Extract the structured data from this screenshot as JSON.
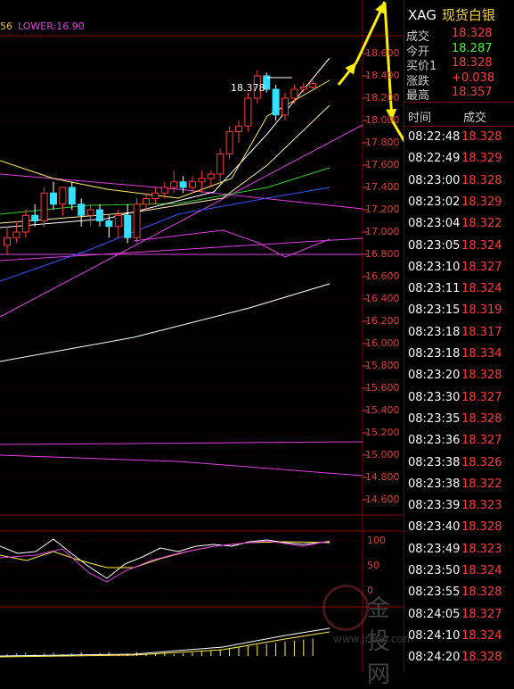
{
  "legend": {
    "partial": "56",
    "lower": "LOWER:16.90"
  },
  "high_marker": "18.378",
  "price_axis": [
    "18.600",
    "18.400",
    "18.200",
    "18.000",
    "17.800",
    "17.600",
    "17.400",
    "17.200",
    "17.000",
    "16.800",
    "16.600",
    "16.400",
    "16.200",
    "16.000",
    "15.800",
    "15.600",
    "15.400",
    "15.200",
    "15.000",
    "14.800",
    "14.600"
  ],
  "indicator_axis": [
    "100",
    "50",
    "0"
  ],
  "quote": {
    "symbol": "XAG",
    "name": "现货白银",
    "rows": [
      {
        "label": "成交",
        "value": "18.328",
        "color": "#ff3a3a"
      },
      {
        "label": "今开",
        "value": "18.287",
        "color": "#33ff33"
      },
      {
        "label": "买价1",
        "value": "18.328",
        "color": "#ff3a3a"
      },
      {
        "label": "涨跌",
        "value": "+0.038",
        "color": "#ff3a3a"
      },
      {
        "label": "最高",
        "value": "18.357",
        "color": "#ff3a3a"
      }
    ]
  },
  "ticks": {
    "header_time": "时间",
    "header_price": "成交",
    "rows": [
      {
        "time": "08:22:48",
        "price": "18.328"
      },
      {
        "time": "08:22:49",
        "price": "18.329"
      },
      {
        "time": "08:23:00",
        "price": "18.328"
      },
      {
        "time": "08:23:02",
        "price": "18.329"
      },
      {
        "time": "08:23:04",
        "price": "18.322"
      },
      {
        "time": "08:23:05",
        "price": "18.324"
      },
      {
        "time": "08:23:10",
        "price": "18.327"
      },
      {
        "time": "08:23:11",
        "price": "18.324"
      },
      {
        "time": "08:23:15",
        "price": "18.319"
      },
      {
        "time": "08:23:18",
        "price": "18.317"
      },
      {
        "time": "08:23:18",
        "price": "18.334"
      },
      {
        "time": "08:23:20",
        "price": "18.328"
      },
      {
        "time": "08:23:30",
        "price": "18.327"
      },
      {
        "time": "08:23:35",
        "price": "18.328"
      },
      {
        "time": "08:23:36",
        "price": "18.327"
      },
      {
        "time": "08:23:38",
        "price": "18.326"
      },
      {
        "time": "08:23:38",
        "price": "18.322"
      },
      {
        "time": "08:23:39",
        "price": "18.323"
      },
      {
        "time": "08:23:40",
        "price": "18.328"
      },
      {
        "time": "08:23:49",
        "price": "18.323"
      },
      {
        "time": "08:23:50",
        "price": "18.324"
      },
      {
        "time": "08:23:55",
        "price": "18.328"
      },
      {
        "time": "08:24:05",
        "price": "18.327"
      },
      {
        "time": "08:24:10",
        "price": "18.324"
      },
      {
        "time": "08:24:20",
        "price": "18.328"
      }
    ]
  },
  "watermark": {
    "brand": "金投网",
    "url": "www.jrwei.com"
  },
  "colors": {
    "up": "#ff3a3a",
    "down": "#33e0ff",
    "panel_border": "#8a0000",
    "annotation": "#ffee00"
  },
  "candles": [
    [
      16.88,
      17.05,
      16.8,
      16.95
    ],
    [
      16.95,
      17.1,
      16.9,
      17.0
    ],
    [
      17.0,
      17.2,
      16.95,
      17.15
    ],
    [
      17.15,
      17.25,
      17.05,
      17.1
    ],
    [
      17.1,
      17.4,
      17.05,
      17.35
    ],
    [
      17.35,
      17.45,
      17.2,
      17.25
    ],
    [
      17.25,
      17.4,
      17.15,
      17.4
    ],
    [
      17.4,
      17.45,
      17.2,
      17.25
    ],
    [
      17.25,
      17.3,
      17.05,
      17.15
    ],
    [
      17.15,
      17.25,
      17.05,
      17.2
    ],
    [
      17.2,
      17.25,
      17.05,
      17.1
    ],
    [
      17.1,
      17.15,
      16.95,
      17.05
    ],
    [
      17.05,
      17.2,
      16.95,
      17.15
    ],
    [
      17.15,
      17.25,
      16.9,
      16.95
    ],
    [
      16.95,
      17.3,
      16.9,
      17.25
    ],
    [
      17.25,
      17.35,
      17.2,
      17.3
    ],
    [
      17.3,
      17.4,
      17.25,
      17.35
    ],
    [
      17.35,
      17.45,
      17.3,
      17.4
    ],
    [
      17.4,
      17.55,
      17.35,
      17.45
    ],
    [
      17.45,
      17.5,
      17.35,
      17.4
    ],
    [
      17.4,
      17.5,
      17.35,
      17.45
    ],
    [
      17.45,
      17.55,
      17.35,
      17.48
    ],
    [
      17.48,
      17.55,
      17.4,
      17.52
    ],
    [
      17.52,
      17.75,
      17.45,
      17.7
    ],
    [
      17.7,
      17.95,
      17.65,
      17.9
    ],
    [
      17.9,
      18.0,
      17.8,
      17.95
    ],
    [
      17.95,
      18.25,
      17.9,
      18.2
    ],
    [
      18.2,
      18.45,
      18.15,
      18.4
    ],
    [
      18.4,
      18.43,
      18.25,
      18.28
    ],
    [
      18.28,
      18.32,
      18.0,
      18.05
    ],
    [
      18.05,
      18.25,
      18.0,
      18.2
    ],
    [
      18.2,
      18.32,
      18.15,
      18.28
    ],
    [
      18.28,
      18.34,
      18.25,
      18.3
    ],
    [
      18.3,
      18.36,
      18.28,
      18.33
    ]
  ]
}
